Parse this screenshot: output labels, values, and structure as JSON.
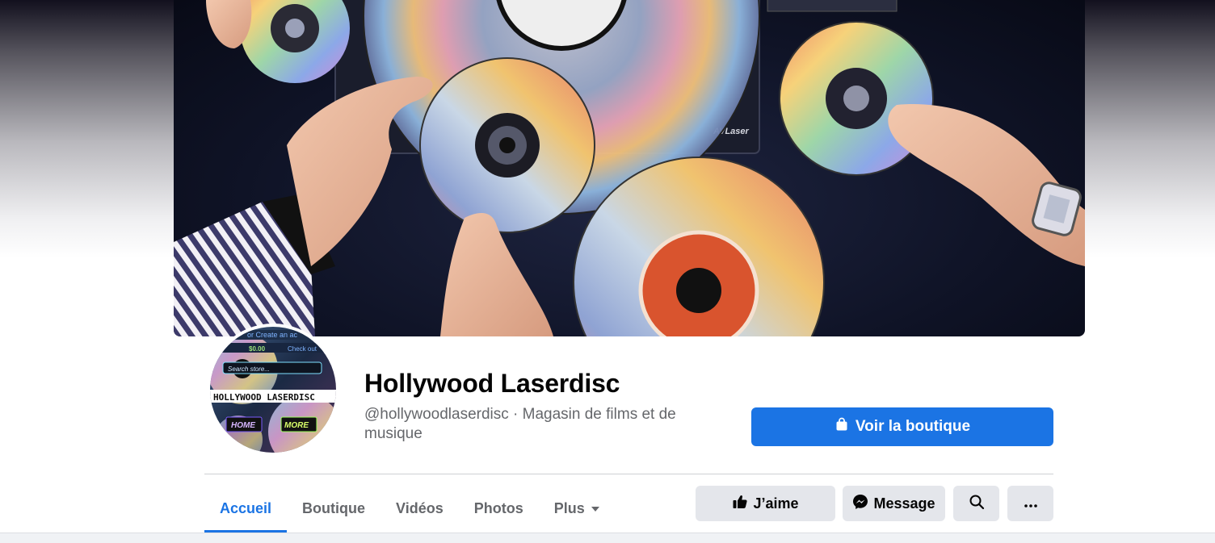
{
  "page": {
    "name": "Hollywood Laserdisc",
    "subtitle": "@hollywoodlaserdisc · Magasin de films et de musique"
  },
  "cover": {
    "description_icon": "laserdisc-cover-photo",
    "player_brand": "AVLaser"
  },
  "avatar": {
    "brand_text": "HOLLYWOOD LASERDISC",
    "search_text": "Search store...",
    "home_label": "HOME",
    "more_label": "MORE",
    "price_text": "$0.00",
    "login_text": "or Create an ac",
    "check_text": "Check out"
  },
  "shop_button": {
    "label": "Voir la boutique",
    "icon": "shopping-bag-icon"
  },
  "tabs": [
    {
      "label": "Accueil",
      "active": true
    },
    {
      "label": "Boutique",
      "active": false
    },
    {
      "label": "Vidéos",
      "active": false
    },
    {
      "label": "Photos",
      "active": false
    },
    {
      "label": "Plus",
      "active": false
    }
  ],
  "actions": {
    "like_label": "J’aime",
    "message_label": "Message"
  },
  "colors": {
    "accent": "#1b74e4",
    "secondary_text": "#65676b",
    "button_gray": "#e4e6eb"
  }
}
